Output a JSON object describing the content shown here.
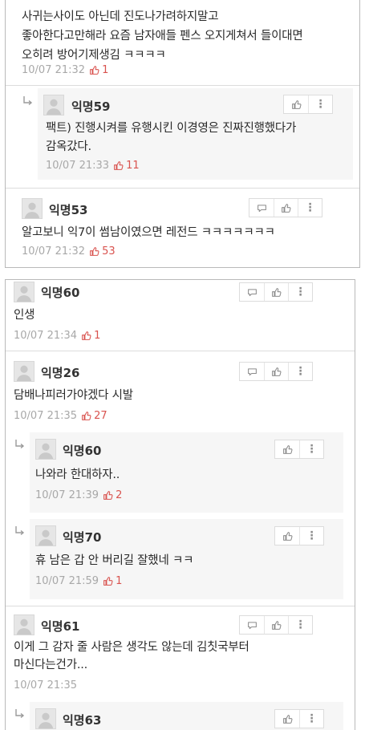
{
  "panel_top": {
    "top_comment": {
      "text_line1": "사귀는사이도 아닌데 진도나가려하지말고",
      "text_line2": "좋아한다고만해라 요즘 남자애들 펜스 오지게쳐서 들이대면",
      "text_line3": "오히려 방어기제생김 ㅋㅋㅋㅋ",
      "time": "10/07 21:32",
      "likes": "1"
    },
    "reply_59": {
      "nickname": "익명59",
      "text_line1": "팩트) 진행시켜를 유행시킨 이경영은 진짜진행했다가",
      "text_line2": "감옥갔다.",
      "time": "10/07 21:33",
      "likes": "11"
    },
    "comment_53": {
      "nickname": "익명53",
      "text": "알고보니 익7이 썸남이였으면 레전드 ㅋㅋㅋㅋㅋㅋㅋ",
      "time": "10/07 21:32",
      "likes": "53"
    }
  },
  "panel_bottom": {
    "comment_60": {
      "nickname": "익명60",
      "text": "인생",
      "time": "10/07 21:34",
      "likes": "1"
    },
    "comment_26": {
      "nickname": "익명26",
      "text": "담배나피러가야겠다 시발",
      "time": "10/07 21:35",
      "likes": "27"
    },
    "reply_60": {
      "nickname": "익명60",
      "text": "나와라 한대하자..",
      "time": "10/07 21:39",
      "likes": "2"
    },
    "reply_70": {
      "nickname": "익명70",
      "text": "휴 남은 갑 안 버리길 잘했네 ㅋㅋ",
      "time": "10/07 21:59",
      "likes": "1"
    },
    "comment_61": {
      "nickname": "익명61",
      "text_line1": "이게 그 감자 줄 사람은 생각도 않는데 김칫국부터",
      "text_line2": "마신다는건가...",
      "time": "10/07 21:35"
    },
    "reply_63": {
      "nickname": "익명63"
    }
  },
  "icons": {
    "comment": "speech-bubble-icon",
    "like": "thumbs-up-icon",
    "more": "vertical-dots-icon",
    "reply_arrow": "reply-arrow-icon",
    "avatar": "default-avatar-icon"
  },
  "colors": {
    "like_count": "#d9534f",
    "meta_gray": "#a8a8a8",
    "border": "#b9b9b9",
    "reply_bg": "#f6f6f6"
  }
}
